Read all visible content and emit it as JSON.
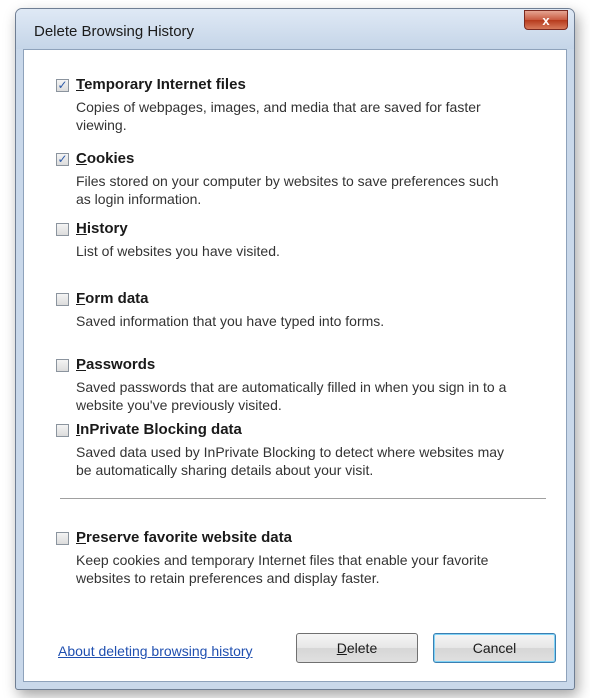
{
  "window": {
    "title": "Delete Browsing History",
    "close_label": "x"
  },
  "options": [
    {
      "label_first": "T",
      "label_rest": "emporary Internet files",
      "checked": true,
      "description": "Copies of webpages, images, and media that are saved for faster viewing."
    },
    {
      "label_first": "C",
      "label_rest": "ookies",
      "checked": true,
      "description": "Files stored on your computer by websites to save preferences such as login information."
    },
    {
      "label_first": "H",
      "label_rest": "istory",
      "checked": false,
      "description": "List of websites you have visited."
    },
    {
      "label_first": "F",
      "label_rest": "orm data",
      "checked": false,
      "description": "Saved information that you have typed into forms."
    },
    {
      "label_first": "P",
      "label_rest": "asswords",
      "checked": false,
      "description": "Saved passwords that are automatically filled in when you sign in to a website you've previously visited."
    },
    {
      "label_first": "I",
      "label_rest": "nPrivate Blocking data",
      "checked": false,
      "description": "Saved data used by InPrivate Blocking to detect where websites may be automatically sharing details about your visit."
    },
    {
      "label_first": "P",
      "label_rest": "reserve favorite website data",
      "checked": false,
      "description": "Keep cookies and temporary Internet files that enable your favorite websites to retain preferences and display faster."
    }
  ],
  "footer": {
    "about_link": "About deleting browsing history",
    "delete_first": "D",
    "delete_rest": "elete",
    "cancel_label": "Cancel"
  }
}
